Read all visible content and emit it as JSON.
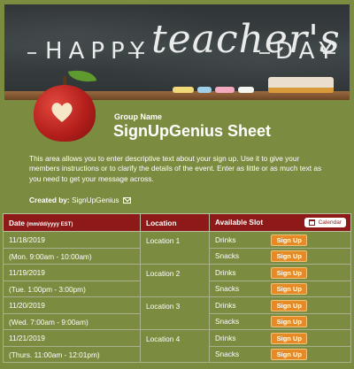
{
  "banner": {
    "word_happy": "HAPPY",
    "word_teachers": "teacher's",
    "word_day": "DAY"
  },
  "header": {
    "group_name": "Group Name",
    "title": "SignUpGenius Sheet"
  },
  "description": "This area allows you to enter descriptive text about your sign up. Use it to give your members instructions or to clarify the details of the event. Enter as little or as much text as you need to get your message across.",
  "created_by": {
    "label": "Created by:",
    "name": "SignUpGenius"
  },
  "table": {
    "headers": {
      "date": "Date",
      "date_format": "(mm/dd/yyyy EST)",
      "location": "Location",
      "slot": "Available Slot",
      "calendar": "Calendar"
    },
    "signup_label": "Sign Up",
    "rows": [
      {
        "date": "11/18/2019",
        "time": "(Mon. 9:00am - 10:00am)",
        "location": "Location 1",
        "slots": [
          "Drinks",
          "Snacks"
        ]
      },
      {
        "date": "11/19/2019",
        "time": "(Tue. 1:00pm - 3:00pm)",
        "location": "Location 2",
        "slots": [
          "Drinks",
          "Snacks"
        ]
      },
      {
        "date": "11/20/2019",
        "time": "(Wed. 7:00am - 9:00am)",
        "location": "Location 3",
        "slots": [
          "Drinks",
          "Snacks"
        ]
      },
      {
        "date": "11/21/2019",
        "time": "(Thurs. 11:00am - 12:01pm)",
        "location": "Location 4",
        "slots": [
          "Drinks",
          "Snacks"
        ]
      }
    ]
  },
  "icons": {
    "apple": "apple-heart-icon",
    "mail": "mail-icon",
    "calendar": "calendar-icon"
  },
  "colors": {
    "background": "#7b8b40",
    "table_header": "#8d1a18",
    "signup_button": "#e58a25",
    "chalkboard": "#363c3e"
  }
}
